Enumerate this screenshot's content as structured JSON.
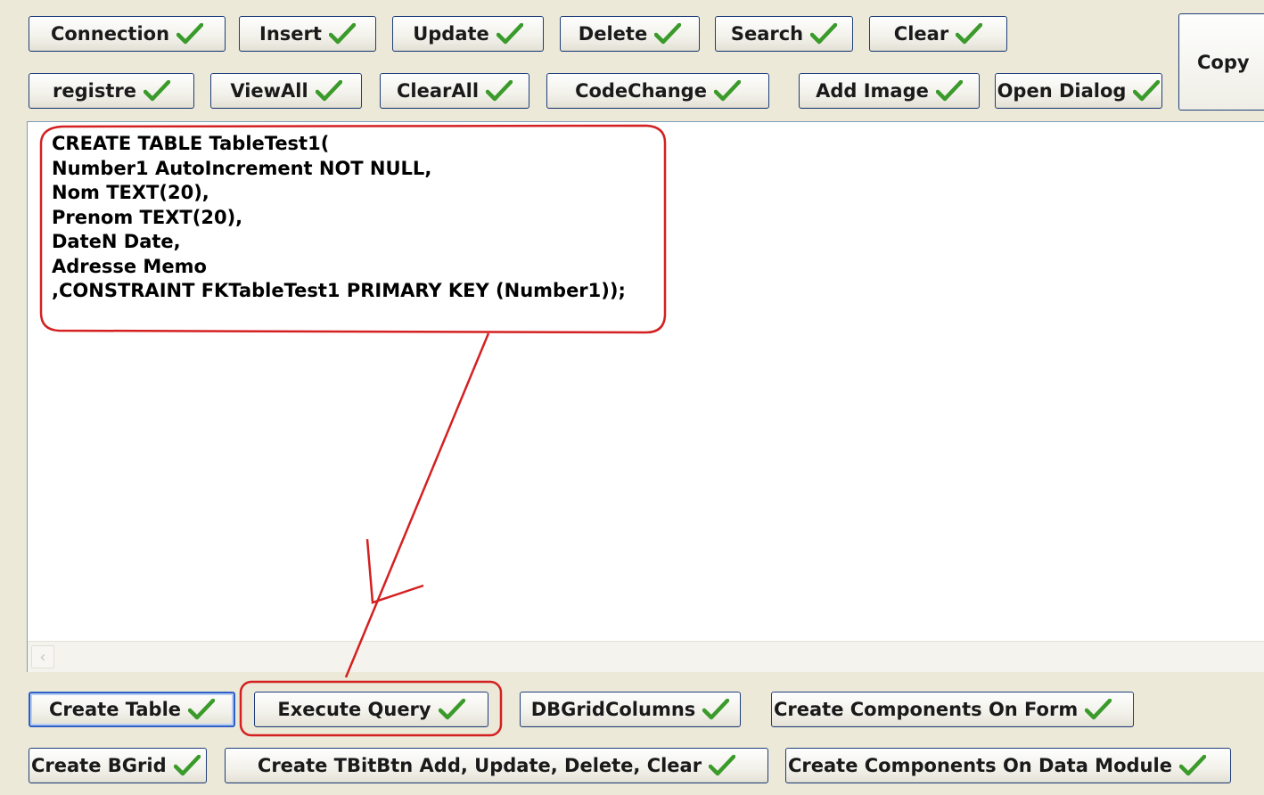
{
  "toolbar": {
    "row1": [
      "Connection",
      "Insert",
      "Update",
      "Delete",
      "Search",
      "Clear"
    ],
    "row2": [
      "registre",
      "ViewAll",
      "ClearAll",
      "CodeChange",
      "Add Image",
      "Open Dialog"
    ],
    "copy_label": "Copy"
  },
  "editor": {
    "sql": "CREATE TABLE TableTest1(\nNumber1 AutoIncrement NOT NULL,\nNom TEXT(20),\nPrenom TEXT(20),\nDateN Date,\nAdresse Memo\n,CONSTRAINT FKTableTest1 PRIMARY KEY (Number1));"
  },
  "bottom": {
    "row1": [
      "Create Table",
      "Execute Query",
      "DBGridColumns",
      "Create Components On Form"
    ],
    "row2": [
      "Create BGrid",
      "Create TBitBtn Add, Update, Delete, Clear",
      "Create Components On Data Module"
    ]
  },
  "colors": {
    "annotation": "#d42020",
    "check": "#3a9a2a",
    "border": "#1e3e7b"
  },
  "icons": {
    "check": "checkmark-icon",
    "scroll_left": "scroll-left-arrow-icon"
  }
}
